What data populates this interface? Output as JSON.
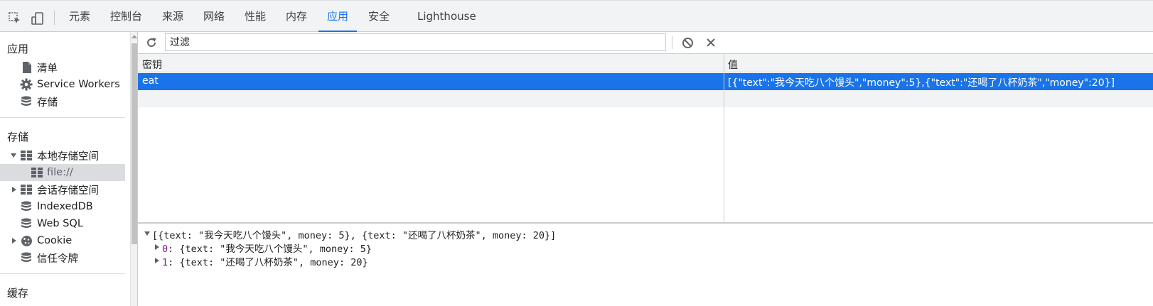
{
  "tabs": {
    "elements": "元素",
    "console": "控制台",
    "sources": "来源",
    "network": "网络",
    "performance": "性能",
    "memory": "内存",
    "application": "应用",
    "security": "安全",
    "lighthouse": "Lighthouse",
    "active": "应用"
  },
  "sidebar": {
    "application_title": "应用",
    "manifest": "清单",
    "service_workers": "Service Workers",
    "storage_overview": "存储",
    "storage_title": "存储",
    "local_storage": "本地存储空间",
    "local_storage_origin": "file://",
    "session_storage": "会话存储空间",
    "indexeddb": "IndexedDB",
    "websql": "Web SQL",
    "cookie": "Cookie",
    "trust_tokens": "信任令牌",
    "cache_title": "缓存"
  },
  "toolbar": {
    "filter_placeholder": "过滤",
    "filter_value": ""
  },
  "grid": {
    "col_key": "密钥",
    "col_value": "值",
    "rows": [
      {
        "key": "eat",
        "value": "[{\"text\":\"我今天吃八个馒头\",\"money\":5},{\"text\":\"还喝了八杯奶茶\",\"money\":20}]"
      }
    ]
  },
  "preview": {
    "root": "[{text: \"我今天吃八个馒头\", money: 5}, {text: \"还喝了八杯奶茶\", money: 20}]",
    "item0_index": "0",
    "item0_body": ": {text: \"我今天吃八个馒头\", money: 5}",
    "item1_index": "1",
    "item1_body": ": {text: \"还喝了八杯奶茶\", money: 20}"
  },
  "colors": {
    "accent": "#1a73e8",
    "selected_row": "#1a73e8",
    "index_color": "#881391"
  }
}
